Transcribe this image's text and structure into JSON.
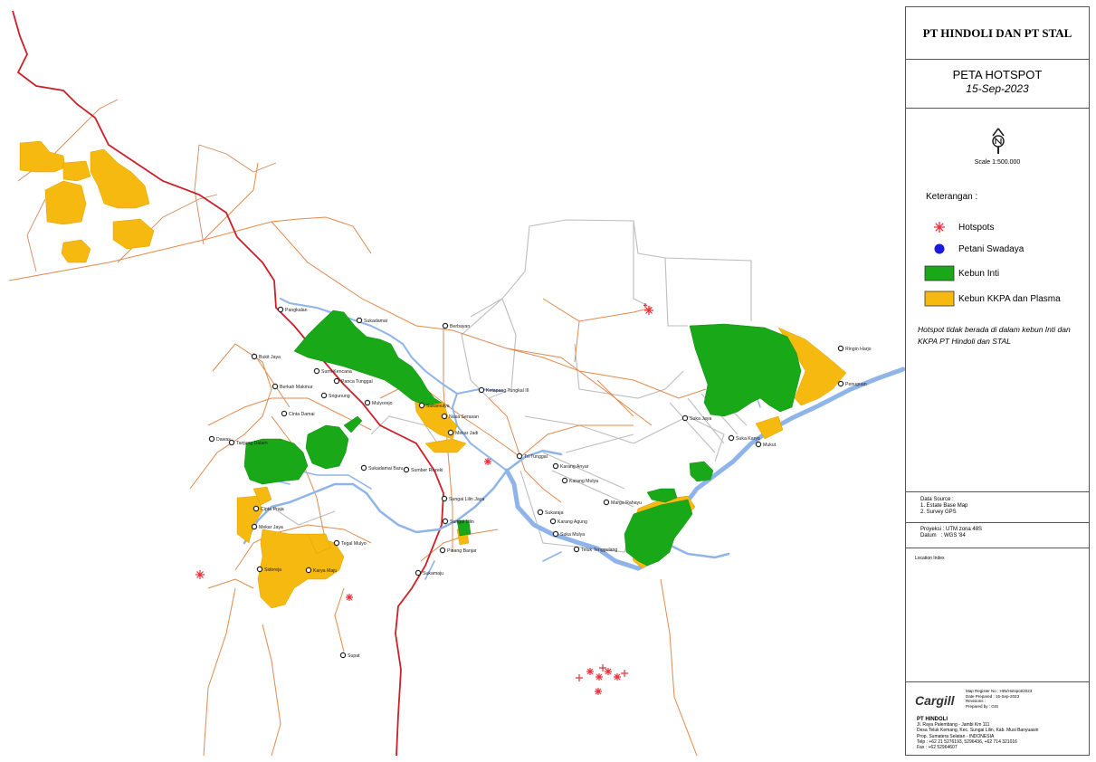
{
  "header": {
    "company": "PT HINDOLI DAN PT STAL",
    "title": "PETA HOTSPOT",
    "date": "15-Sep-2023"
  },
  "scale": "Scale 1:500.000",
  "legend": {
    "heading": "Keterangan :",
    "items": [
      {
        "label": "Hotspots",
        "symbol": "asterisk",
        "color": "#e8303a"
      },
      {
        "label": "Petani Swadaya",
        "symbol": "circle",
        "color": "#1a1adc"
      },
      {
        "label": "Kebun Inti",
        "symbol": "square",
        "color": "#18a818"
      },
      {
        "label": "Kebun KKPA dan Plasma",
        "symbol": "square",
        "color": "#f6b90f"
      }
    ]
  },
  "note": "Hotspot tidak berada di dalam kebun Inti dan KKPA PT Hindoli dan STAL",
  "data_source": {
    "heading": "Data Source :",
    "items": [
      "1. Estate Base Map",
      "2. Survey GPS"
    ]
  },
  "projection": {
    "proyeksi_label": "Proyeksi",
    "proyeksi": "UTM zona 48S",
    "datum_label": "Datum",
    "datum": "WGS '84"
  },
  "location_index": "Location Index",
  "footer": {
    "logo": "Cargill",
    "meta": [
      {
        "k": "Map Register No",
        "v": "HIN/Hotspot/2023"
      },
      {
        "k": "Date Prepared",
        "v": "15-Sep-2023"
      },
      {
        "k": "Revisions",
        "v": ""
      },
      {
        "k": "Prepared by",
        "v": "GIS"
      }
    ],
    "company": "PT HINDOLI",
    "address": [
      "Jl. Raya Palembang - Jambi Km 111",
      "Desa Teluk Kemang, Kec. Sungai Lilin, Kab. Musi Banyuasin",
      "Prop. Sumatera Selatan - INDONESIA",
      "Telp : +62 21 5276193, 5296436, +62 714 321016",
      "Fax : +62 52964607"
    ]
  },
  "map": {
    "places": [
      "Pangkalan",
      "Sukadamai",
      "Berbayan",
      "Bukit Jaya",
      "Sumi Kencana",
      "Panca Tunggal",
      "Berkah Makmur",
      "Srigunung",
      "Mulyorejo",
      "Cinta Damai",
      "Sukamulya",
      "Nusa Serasan",
      "Ketapang Tungkal III",
      "Mekar Jadi",
      "Dawas",
      "Tanjung Dalam",
      "Sukadamai Baru",
      "Sumber Rezeki",
      "Tri Tunggal",
      "Karang Anyar",
      "Karang Mulya",
      "Cipta Praja",
      "Sungai Lilin Jaya",
      "Sungai Lilin",
      "Mekar Jaya",
      "Tegal Mulyo",
      "Pinang Banjar",
      "Sidoreja",
      "Karya Maju",
      "Sukaraja",
      "Karang Agung",
      "Suka Mulya",
      "Marga Rahayu",
      "Teluk Tenggulang",
      "Sukamaju",
      "Supat",
      "Suka Jaya",
      "Suka Karya",
      "Mukut",
      "Ringin Harjo",
      "Penuguan"
    ]
  }
}
